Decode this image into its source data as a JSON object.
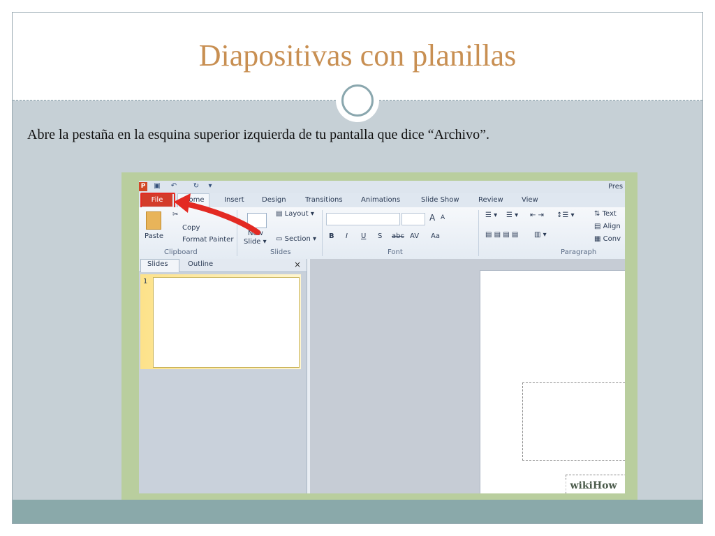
{
  "slide": {
    "title": "Diapositivas con planillas",
    "body": "Abre la pestaña en la esquina superior izquierda de tu pantalla que dice “Archivo”."
  },
  "screenshot": {
    "window_title": "Pres",
    "tabs": {
      "file": "File",
      "home": "Home",
      "insert": "Insert",
      "design": "Design",
      "transitions": "Transitions",
      "animations": "Animations",
      "slide_show": "Slide Show",
      "review": "Review",
      "view": "View"
    },
    "ribbon": {
      "paste": "Paste",
      "cut": "✂",
      "copy": "Copy",
      "format_painter": "Format Painter",
      "clipboard": "Clipboard",
      "new_slide_line1": "New",
      "new_slide_line2": "Slide ▾",
      "layout": "Layout ▾",
      "section": "Section ▾",
      "slides": "Slides",
      "font": "Font",
      "paragraph": "Paragraph",
      "text_direction": "Text",
      "align": "Align",
      "convert": "Conv",
      "bold": "B",
      "italic": "I",
      "underline": "U",
      "strike": "S",
      "abc": "abc",
      "av": "AV",
      "aa": "Aa",
      "grow": "A",
      "shrink": "A"
    },
    "pane": {
      "slides_tab": "Slides",
      "outline_tab": "Outline",
      "close": "×",
      "slide_number": "1"
    },
    "watermark": "wikiHow"
  },
  "colors": {
    "title": "#c88f52",
    "background": "#c6d0d6",
    "bottom_band": "#8aa9aa",
    "file_tab": "#d33c2b",
    "arrow": "#e32a23"
  }
}
